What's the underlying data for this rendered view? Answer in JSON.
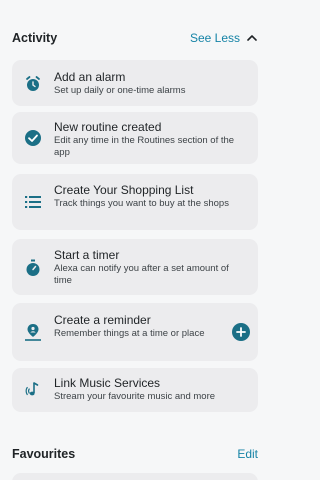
{
  "activity": {
    "title": "Activity",
    "see_less": "See Less"
  },
  "cards": [
    {
      "title": "Add an alarm",
      "desc": "Set up daily or one-time alarms",
      "icon": "alarm-clock-icon"
    },
    {
      "title": "New routine created",
      "desc": "Edit any time in the Routines section of the app",
      "icon": "check-circle-icon"
    },
    {
      "title": "Create Your Shopping List",
      "desc": "Track things you want to buy at the shops",
      "icon": "list-icon"
    },
    {
      "title": "Start a timer",
      "desc": "Alexa can notify you after a set amount of time",
      "icon": "timer-icon"
    },
    {
      "title": "Create a reminder",
      "desc": "Remember things at a time or place",
      "icon": "location-person-icon"
    },
    {
      "title": "Link Music Services",
      "desc": "Stream your favourite music and more",
      "icon": "music-note-icon"
    }
  ],
  "favourites": {
    "title": "Favourites",
    "edit": "Edit"
  },
  "colors": {
    "accent": "#1583a6",
    "icon": "#1b6f86",
    "card": "#ececee",
    "background": "#f6f7f8"
  }
}
